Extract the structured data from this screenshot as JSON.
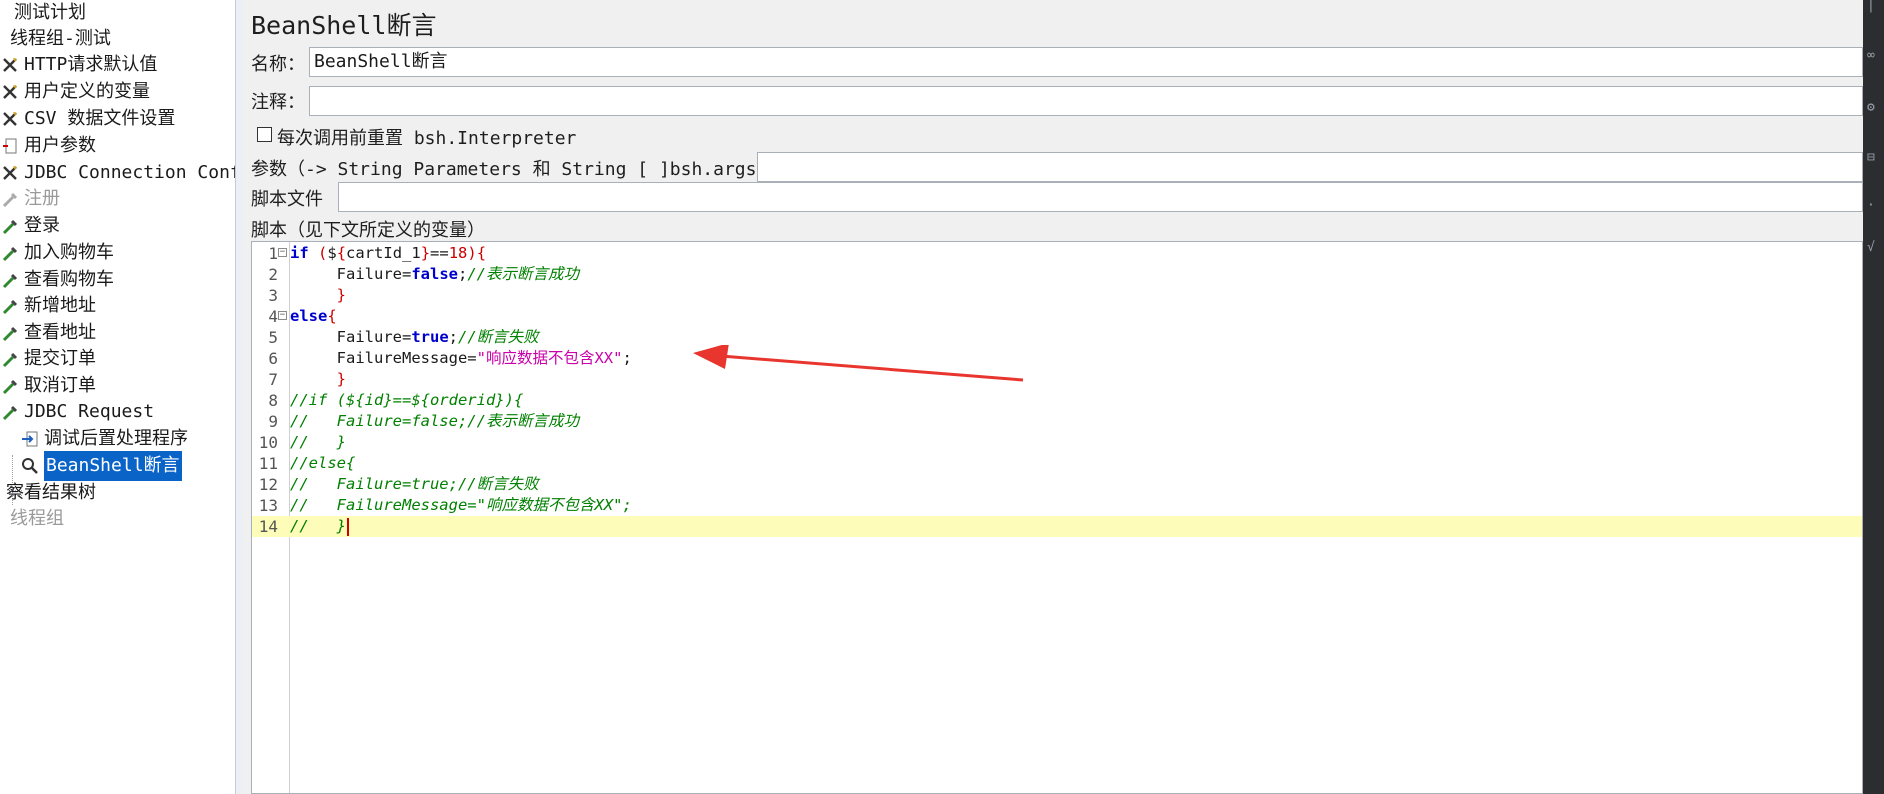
{
  "tree": {
    "items": [
      {
        "label": "测试计划",
        "icon": "test-plan-icon",
        "state": "normal"
      },
      {
        "label": "线程组-测试",
        "icon": "thread-group-icon",
        "state": "normal"
      },
      {
        "label": "HTTP请求默认值",
        "icon": "wrench-icon",
        "state": "normal"
      },
      {
        "label": "用户定义的变量",
        "icon": "wrench-icon",
        "state": "normal"
      },
      {
        "label": "CSV 数据文件设置",
        "icon": "wrench-icon",
        "state": "normal"
      },
      {
        "label": "用户参数",
        "icon": "user-params-icon",
        "state": "normal"
      },
      {
        "label": "JDBC Connection Configuration",
        "icon": "wrench-icon",
        "state": "normal"
      },
      {
        "label": "注册",
        "icon": "pipette-icon",
        "state": "disabled"
      },
      {
        "label": "登录",
        "icon": "pipette-icon",
        "state": "normal"
      },
      {
        "label": "加入购物车",
        "icon": "pipette-icon",
        "state": "normal"
      },
      {
        "label": "查看购物车",
        "icon": "pipette-icon",
        "state": "normal"
      },
      {
        "label": "新增地址",
        "icon": "pipette-icon",
        "state": "normal"
      },
      {
        "label": "查看地址",
        "icon": "pipette-icon",
        "state": "normal"
      },
      {
        "label": "提交订单",
        "icon": "pipette-icon",
        "state": "normal"
      },
      {
        "label": "取消订单",
        "icon": "pipette-icon",
        "state": "normal"
      },
      {
        "label": "JDBC Request",
        "icon": "pipette-icon",
        "state": "normal"
      },
      {
        "label": "调试后置处理程序",
        "icon": "postprocessor-icon",
        "state": "normal"
      },
      {
        "label": "BeanShell断言",
        "icon": "magnifier-icon",
        "state": "selected"
      },
      {
        "label": "察看结果树",
        "icon": "listener-icon",
        "state": "normal"
      },
      {
        "label": "线程组",
        "icon": "thread-group-icon",
        "state": "disabled"
      }
    ]
  },
  "panel": {
    "title": "BeanShell断言",
    "name_label": "名称：",
    "name_value": "BeanShell断言",
    "comment_label": "注释：",
    "comment_value": "",
    "reset_checkbox_label": "每次调用前重置 bsh.Interpreter",
    "reset_checked": false,
    "params_label": "参数（-> String Parameters 和 String [ ]bsh.args）",
    "params_value": "",
    "script_file_label": "脚本文件",
    "script_file_value": "",
    "script_label": "脚本（见下文所定义的变量）"
  },
  "editor": {
    "current_line": 14,
    "lines": [
      "if (${cartId_1}==18){",
      "     Failure=false;//表示断言成功",
      "     }",
      "else{",
      "     Failure=true;//断言失败",
      "     FailureMessage=\"响应数据不包含XX\";",
      "     }",
      "//if (${id}==${orderid}){",
      "//   Failure=false;//表示断言成功",
      "//   }",
      "//else{",
      "//   Failure=true;//断言失败",
      "//   FailureMessage=\"响应数据不包含XX\";",
      "//   }"
    ]
  },
  "colors": {
    "selection": "#0a64c8",
    "current_line": "#fdfcb8",
    "annotation_arrow": "#e8362e",
    "keyword": "#0000cc",
    "comment": "#008000",
    "string": "#cc00aa"
  }
}
